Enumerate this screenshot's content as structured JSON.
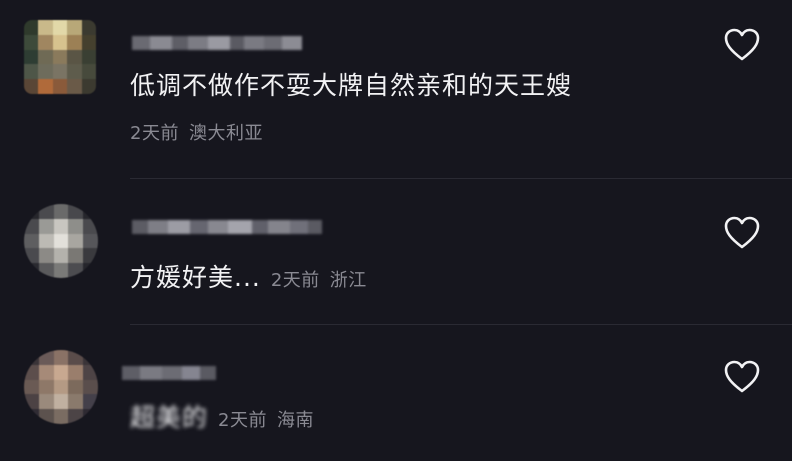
{
  "comments": [
    {
      "text": "低调不做作不耍大牌自然亲和的天王嫂",
      "time": "2天前",
      "location": "澳大利亚",
      "like_icon": "heart-outline-icon"
    },
    {
      "text": "方媛好美...",
      "time": "2天前",
      "location": "浙江",
      "like_icon": "heart-outline-icon"
    },
    {
      "text": "超美的",
      "time": "2天前",
      "location": "海南",
      "like_icon": "heart-outline-icon"
    }
  ],
  "colors": {
    "background": "#16161e",
    "text_primary": "#f2f2f4",
    "text_secondary": "#8a8a93",
    "divider": "#2a2a33"
  }
}
